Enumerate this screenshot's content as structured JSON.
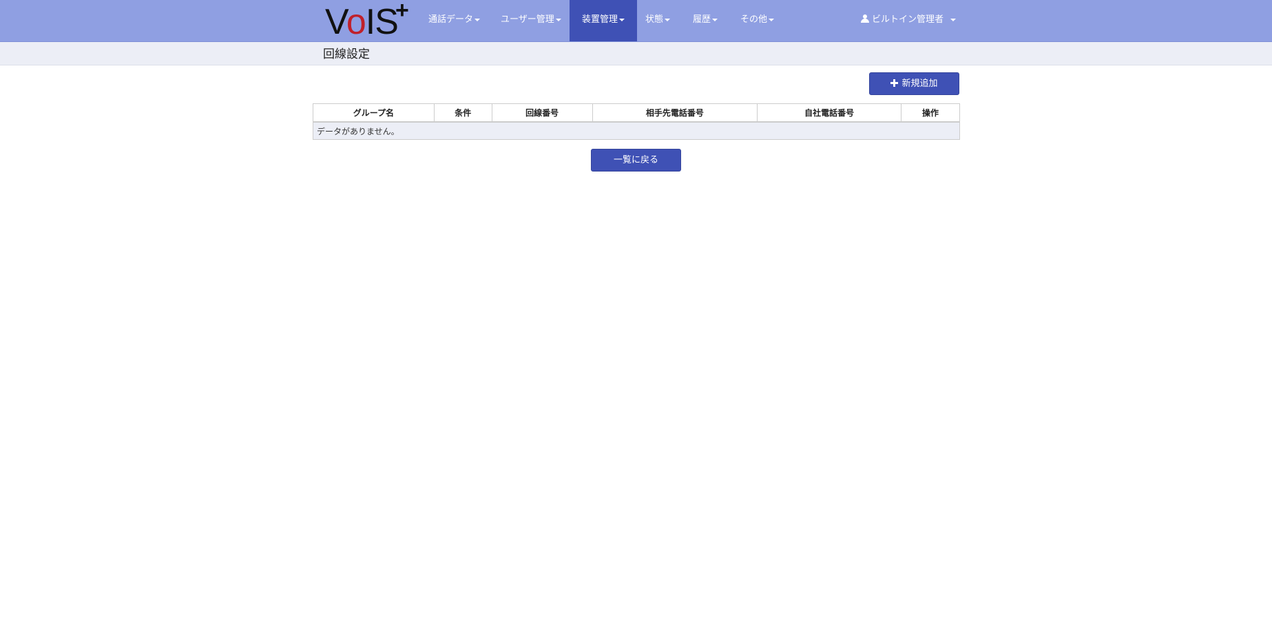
{
  "app": {
    "logo_main": "VoIS",
    "logo_o": "o",
    "logo_v": "V",
    "logo_is": "IS",
    "logo_plus": "+"
  },
  "nav": {
    "items": [
      {
        "label": "通話データ"
      },
      {
        "label": "ユーザー管理"
      },
      {
        "label": "装置管理",
        "active": true
      },
      {
        "label": "状態"
      },
      {
        "label": "履歴"
      },
      {
        "label": "その他"
      }
    ],
    "user": {
      "label": "ビルトイン管理者",
      "icon": "user-icon"
    }
  },
  "page": {
    "title": "回線設定"
  },
  "toolbar": {
    "add_label": "新規追加",
    "add_icon": "plus-icon"
  },
  "table": {
    "columns": [
      "グループ名",
      "条件",
      "回線番号",
      "相手先電話番号",
      "自社電話番号",
      "操作"
    ],
    "empty_message": "データがありません。"
  },
  "footer": {
    "back_label": "一覧に戻る"
  },
  "colors": {
    "navbar": "#8f9fe2",
    "active_nav": "#3f51b5",
    "button": "#3f51b5",
    "subheader": "#eceef6",
    "logo_accent": "#c0202a"
  }
}
